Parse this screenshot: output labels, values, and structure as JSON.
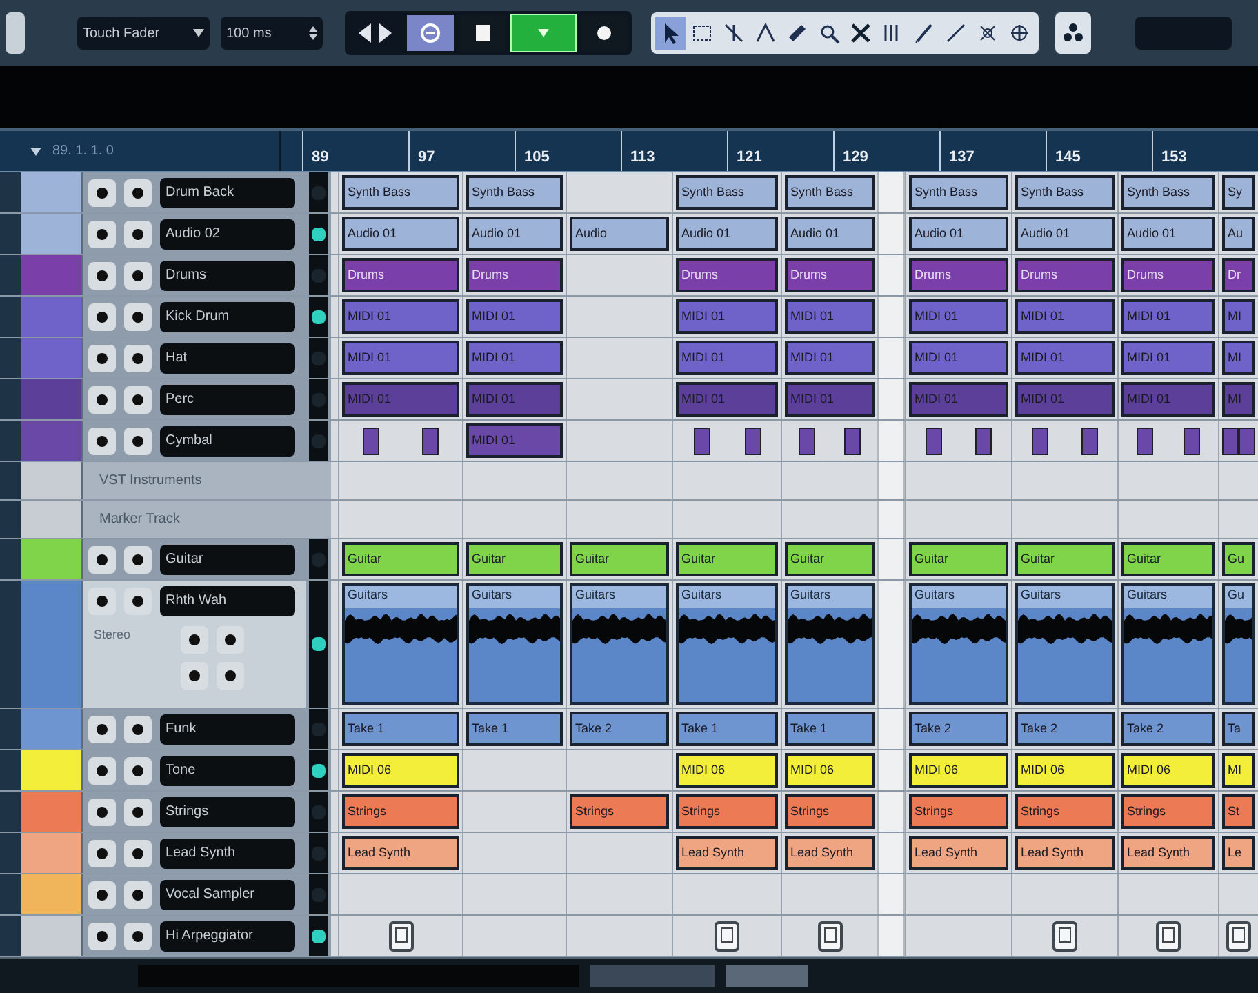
{
  "toolbar": {
    "automation_mode": "Touch Fader",
    "fade_time": "100 ms",
    "buttons": [
      {
        "selected": false
      },
      {
        "selected": false
      },
      {
        "selected": true
      },
      {
        "selected": false
      }
    ],
    "tools": [
      {
        "selected": true
      },
      {
        "selected": false
      },
      {
        "selected": false
      },
      {
        "selected": false
      },
      {
        "selected": false
      },
      {
        "selected": false
      },
      {
        "selected": false
      },
      {
        "selected": false
      },
      {
        "selected": false
      },
      {
        "selected": false
      },
      {
        "selected": false
      },
      {
        "selected": false
      }
    ]
  },
  "ruler": {
    "position": "89. 1. 1. 0",
    "labels": [
      "89",
      "97",
      "105",
      "113",
      "121",
      "129",
      "137",
      "145",
      "153"
    ]
  },
  "tracks": [
    {
      "name": "Drum Back",
      "kind": "audio",
      "color": "#9db4d8",
      "meter_on": false,
      "cells": [
        {
          "label": "Synth Bass"
        },
        {
          "label": "Synth Bass"
        },
        null,
        {
          "label": "Synth Bass"
        },
        {
          "label": "Synth Bass"
        },
        {
          "label": "Synth Bass"
        },
        {
          "label": "Synth Bass"
        },
        {
          "label": "Synth Bass"
        },
        {
          "label": "Sy"
        }
      ]
    },
    {
      "name": "Audio 02",
      "kind": "audio",
      "color": "#9db4d8",
      "meter_on": true,
      "cells": [
        {
          "label": "Audio 01"
        },
        {
          "label": "Audio 01"
        },
        {
          "label": "Audio"
        },
        {
          "label": "Audio 01"
        },
        {
          "label": "Audio 01"
        },
        {
          "label": "Audio 01"
        },
        {
          "label": "Audio 01"
        },
        {
          "label": "Audio 01"
        },
        {
          "label": "Au"
        }
      ]
    },
    {
      "name": "Drums",
      "kind": "folder",
      "color": "#7a3fa8",
      "meter_on": false,
      "cells": [
        {
          "label": "Drums"
        },
        {
          "label": "Drums"
        },
        null,
        {
          "label": "Drums"
        },
        {
          "label": "Drums"
        },
        {
          "label": "Drums"
        },
        {
          "label": "Drums"
        },
        {
          "label": "Drums"
        },
        {
          "label": "Dr"
        }
      ]
    },
    {
      "name": "Kick Drum",
      "kind": "midi",
      "color": "#6f62c8",
      "meter_on": true,
      "cells": [
        {
          "label": "MIDI 01"
        },
        {
          "label": "MIDI 01"
        },
        null,
        {
          "label": "MIDI 01"
        },
        {
          "label": "MIDI 01"
        },
        {
          "label": "MIDI 01"
        },
        {
          "label": "MIDI 01"
        },
        {
          "label": "MIDI 01"
        },
        {
          "label": "MI"
        }
      ]
    },
    {
      "name": "Hat",
      "kind": "midi",
      "color": "#6f62c8",
      "meter_on": false,
      "cells": [
        {
          "label": "MIDI 01"
        },
        {
          "label": "MIDI 01"
        },
        null,
        {
          "label": "MIDI 01"
        },
        {
          "label": "MIDI 01"
        },
        {
          "label": "MIDI 01"
        },
        {
          "label": "MIDI 01"
        },
        {
          "label": "MIDI 01"
        },
        {
          "label": "MI"
        }
      ]
    },
    {
      "name": "Perc",
      "kind": "midi",
      "color": "#5c3f98",
      "meter_on": false,
      "cells": [
        {
          "label": "MIDI 01"
        },
        {
          "label": "MIDI 01"
        },
        null,
        {
          "label": "MIDI 01"
        },
        {
          "label": "MIDI 01"
        },
        {
          "label": "MIDI 01"
        },
        {
          "label": "MIDI 01"
        },
        {
          "label": "MIDI 01"
        },
        {
          "label": "MI"
        }
      ]
    },
    {
      "name": "Cymbal",
      "kind": "midi",
      "color": "#6a48a8",
      "meter_on": false,
      "cells": [
        {
          "kind": "hits"
        },
        {
          "label": "MIDI 01"
        },
        null,
        {
          "kind": "hits"
        },
        {
          "kind": "hits"
        },
        {
          "kind": "hits"
        },
        {
          "kind": "hits"
        },
        {
          "kind": "hits"
        },
        {
          "kind": "hits"
        }
      ]
    },
    {
      "name": "VST Instruments",
      "kind": "instrument",
      "color": "#c8cdd3"
    },
    {
      "name": "Marker Track",
      "kind": "instrument",
      "color": "#c8cdd3"
    },
    {
      "name": "Guitar",
      "kind": "folder",
      "color": "#7fd44a",
      "meter_on": false,
      "cells": [
        {
          "label": "Guitar"
        },
        {
          "label": "Guitar"
        },
        {
          "label": "Guitar"
        },
        {
          "label": "Guitar"
        },
        {
          "label": "Guitar"
        },
        {
          "label": "Guitar"
        },
        {
          "label": "Guitar"
        },
        {
          "label": "Guitar"
        },
        {
          "label": "Gu"
        }
      ]
    },
    {
      "name": "Rhth Wah",
      "kind": "wave",
      "color": "#5b86c8",
      "meter_on": true,
      "sub_label": "Stereo",
      "cells": [
        {
          "label": "Guitars"
        },
        {
          "label": "Guitars"
        },
        {
          "label": "Guitars"
        },
        {
          "label": "Guitars"
        },
        {
          "label": "Guitars"
        },
        {
          "label": "Guitars"
        },
        {
          "label": "Guitars"
        },
        {
          "label": "Guitars"
        },
        {
          "label": "Gu"
        }
      ]
    },
    {
      "name": "Funk",
      "kind": "audio",
      "color": "#6f95d0",
      "meter_on": false,
      "cells": [
        {
          "label": "Take 1"
        },
        {
          "label": "Take 1"
        },
        {
          "label": "Take 2"
        },
        {
          "label": "Take 1"
        },
        {
          "label": "Take 1"
        },
        {
          "label": "Take 2"
        },
        {
          "label": "Take 2"
        },
        {
          "label": "Take 2"
        },
        {
          "label": "Ta"
        }
      ]
    },
    {
      "name": "Tone",
      "kind": "midi",
      "color": "#f2ee3a",
      "meter_on": true,
      "cells": [
        {
          "label": "MIDI 06"
        },
        null,
        null,
        {
          "label": "MIDI 06"
        },
        {
          "label": "MIDI 06"
        },
        {
          "label": "MIDI 06"
        },
        {
          "label": "MIDI 06"
        },
        {
          "label": "MIDI 06"
        },
        {
          "label": "MI"
        }
      ]
    },
    {
      "name": "Strings",
      "kind": "midi",
      "color": "#eb7a55",
      "meter_on": false,
      "cells": [
        {
          "label": "Strings"
        },
        null,
        {
          "label": "Strings"
        },
        {
          "label": "Strings"
        },
        {
          "label": "Strings"
        },
        {
          "label": "Strings"
        },
        {
          "label": "Strings"
        },
        {
          "label": "Strings"
        },
        {
          "label": "St"
        }
      ]
    },
    {
      "name": "Lead Synth",
      "kind": "midi",
      "color": "#efa582",
      "meter_on": false,
      "cells": [
        {
          "label": "Lead Synth"
        },
        null,
        null,
        {
          "label": "Lead Synth"
        },
        {
          "label": "Lead Synth"
        },
        {
          "label": "Lead Synth"
        },
        {
          "label": "Lead Synth"
        },
        {
          "label": "Lead Synth"
        },
        {
          "label": "Le"
        }
      ]
    },
    {
      "name": "Vocal Sampler",
      "kind": "midi",
      "color": "#f0b45a",
      "meter_on": false
    },
    {
      "name": "Hi Arpeggiator",
      "kind": "midi",
      "color": "#c8cdd3",
      "meter_on": true,
      "cells": [
        {
          "kind": "device"
        },
        null,
        null,
        {
          "kind": "device"
        },
        {
          "kind": "device"
        },
        null,
        {
          "kind": "device"
        },
        {
          "kind": "device"
        },
        {
          "kind": "device"
        }
      ]
    }
  ]
}
